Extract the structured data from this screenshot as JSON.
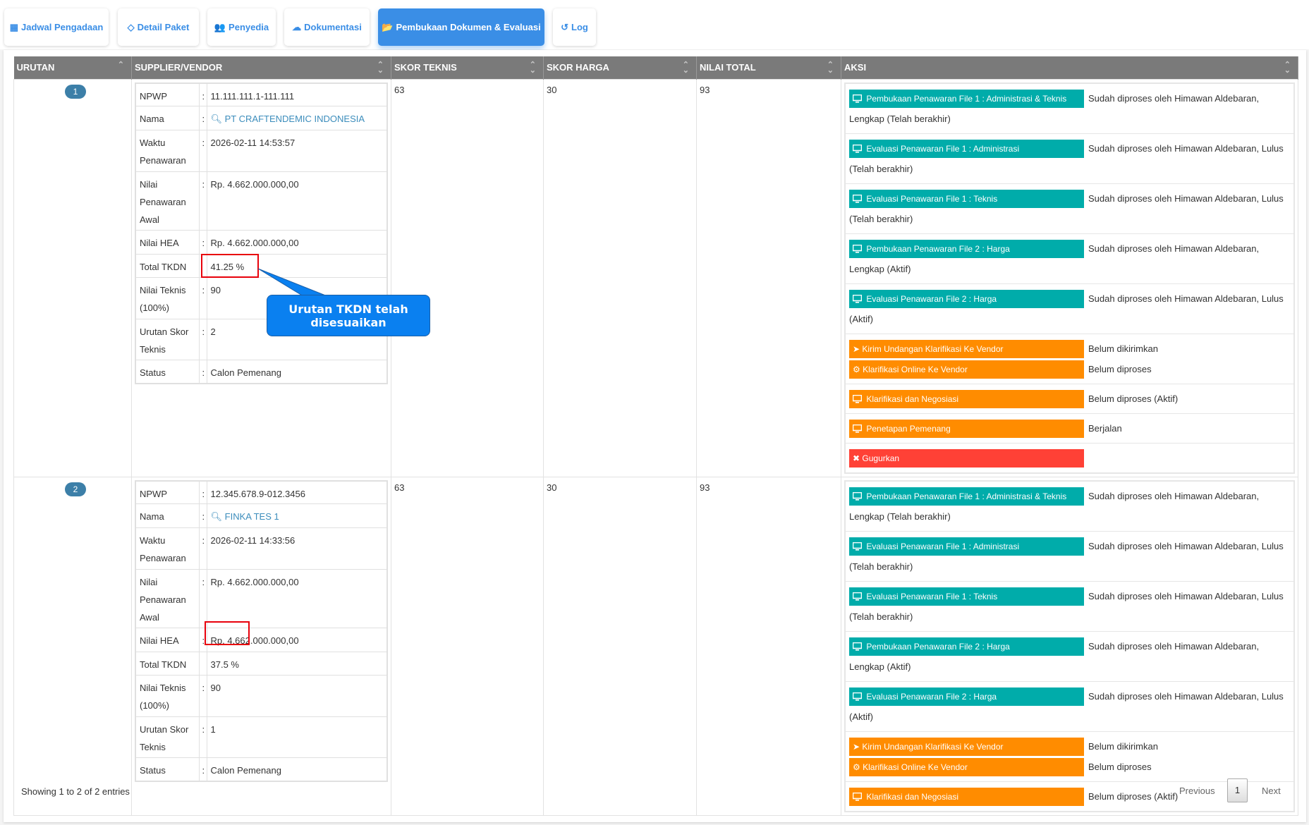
{
  "tabs": [
    {
      "label": "Jadwal Pengadaan",
      "icon": "calendar-icon",
      "glyph": "▦"
    },
    {
      "label": "Detail Paket",
      "icon": "diamond-icon",
      "glyph": "◇"
    },
    {
      "label": "Penyedia",
      "icon": "users-icon",
      "glyph": "👥"
    },
    {
      "label": "Dokumentasi",
      "icon": "cloud-download-icon",
      "glyph": "☁"
    },
    {
      "label": "Pembukaan Dokumen & Evaluasi",
      "icon": "folder-open-icon",
      "glyph": "📂"
    },
    {
      "label": "Log",
      "icon": "history-icon",
      "glyph": "↺"
    }
  ],
  "active_tab": 4,
  "headers": [
    "URUTAN",
    "SUPPLIER/VENDOR",
    "SKOR TEKNIS",
    "SKOR HARGA",
    "NILAI TOTAL",
    "AKSI"
  ],
  "colors": {
    "teal": "#00acaa",
    "orange": "#ff8c00",
    "red": "#ff4136",
    "header": "#7a7a7a",
    "accent": "#3a8ee6"
  },
  "labels": {
    "npwp": "NPWP",
    "nama": "Nama",
    "waktu": "Waktu Penawaran",
    "nilai_awal": "Nilai Penawaran Awal",
    "hea": "Nilai HEA",
    "tkdn": "Total TKDN",
    "teknis": "Nilai Teknis (100%)",
    "urutan": "Urutan Skor Teknis",
    "status": "Status",
    "colon": ":"
  },
  "rows": [
    {
      "urutan": "1",
      "npwp": "11.111.111.1-111.111",
      "nama": "PT CRAFTENDEMIC INDONESIA",
      "waktu": "2026-02-11 14:53:57",
      "nilai_awal": "Rp. 4.662.000.000,00",
      "hea": "Rp. 4.662.000.000,00",
      "tkdn": "41.25 %",
      "teknis": "90",
      "urutan_skor": "2",
      "status": "Calon Pemenang",
      "skor_teknis": "63",
      "skor_harga": "30",
      "nilai_total": "93",
      "aksi": [
        [
          {
            "label": "Pembukaan Penawaran File 1 : Administrasi & Teknis",
            "icon": "monitor",
            "color": "teal",
            "status": "Sudah diproses oleh Himawan Aldebaran, Lengkap (Telah berakhir)"
          }
        ],
        [
          {
            "label": "Evaluasi Penawaran File 1 : Administrasi",
            "icon": "monitor",
            "color": "teal",
            "status": "Sudah diproses oleh Himawan Aldebaran, Lulus (Telah berakhir)"
          }
        ],
        [
          {
            "label": "Evaluasi Penawaran File 1 : Teknis",
            "icon": "monitor",
            "color": "teal",
            "status": "Sudah diproses oleh Himawan Aldebaran, Lulus (Telah berakhir)"
          }
        ],
        [
          {
            "label": "Pembukaan Penawaran File 2 : Harga",
            "icon": "monitor",
            "color": "teal",
            "status": "Sudah diproses oleh Himawan Aldebaran, Lengkap (Aktif)"
          }
        ],
        [
          {
            "label": "Evaluasi Penawaran File 2 : Harga",
            "icon": "monitor",
            "color": "teal",
            "status": "Sudah diproses oleh Himawan Aldebaran, Lulus (Aktif)"
          }
        ],
        [
          {
            "label": "Kirim Undangan Klarifikasi Ke Vendor",
            "icon": "send",
            "color": "orange",
            "status": "Belum dikirimkan"
          },
          {
            "label": "Klarifikasi Online Ke Vendor",
            "icon": "gears",
            "color": "orange",
            "status": "Belum diproses"
          }
        ],
        [
          {
            "label": "Klarifikasi dan Negosiasi",
            "icon": "monitor",
            "color": "orange",
            "status": "Belum diproses (Aktif)"
          }
        ],
        [
          {
            "label": "Penetapan Pemenang",
            "icon": "monitor",
            "color": "orange",
            "status": "Berjalan"
          }
        ],
        [
          {
            "label": "Gugurkan",
            "icon": "close",
            "color": "red",
            "status": ""
          }
        ]
      ]
    },
    {
      "urutan": "2",
      "npwp": "12.345.678.9-012.3456",
      "nama": "FINKA TES 1",
      "waktu": "2026-02-11 14:33:56",
      "nilai_awal": "Rp. 4.662.000.000,00",
      "hea": "Rp. 4.662.000.000,00",
      "tkdn": "37.5 %",
      "teknis": "90",
      "urutan_skor": "1",
      "status": "Calon Pemenang",
      "skor_teknis": "63",
      "skor_harga": "30",
      "nilai_total": "93",
      "aksi": [
        [
          {
            "label": "Pembukaan Penawaran File 1 : Administrasi & Teknis",
            "icon": "monitor",
            "color": "teal",
            "status": "Sudah diproses oleh Himawan Aldebaran, Lengkap (Telah berakhir)"
          }
        ],
        [
          {
            "label": "Evaluasi Penawaran File 1 : Administrasi",
            "icon": "monitor",
            "color": "teal",
            "status": "Sudah diproses oleh Himawan Aldebaran, Lulus (Telah berakhir)"
          }
        ],
        [
          {
            "label": "Evaluasi Penawaran File 1 : Teknis",
            "icon": "monitor",
            "color": "teal",
            "status": "Sudah diproses oleh Himawan Aldebaran, Lulus (Telah berakhir)"
          }
        ],
        [
          {
            "label": "Pembukaan Penawaran File 2 : Harga",
            "icon": "monitor",
            "color": "teal",
            "status": "Sudah diproses oleh Himawan Aldebaran, Lengkap (Aktif)"
          }
        ],
        [
          {
            "label": "Evaluasi Penawaran File 2 : Harga",
            "icon": "monitor",
            "color": "teal",
            "status": "Sudah diproses oleh Himawan Aldebaran, Lulus (Aktif)"
          }
        ],
        [
          {
            "label": "Kirim Undangan Klarifikasi Ke Vendor",
            "icon": "send",
            "color": "orange",
            "status": "Belum dikirimkan"
          },
          {
            "label": "Klarifikasi Online Ke Vendor",
            "icon": "gears",
            "color": "orange",
            "status": "Belum diproses"
          }
        ],
        [
          {
            "label": "Klarifikasi dan Negosiasi",
            "icon": "monitor",
            "color": "orange",
            "status": "Belum diproses (Aktif)"
          }
        ]
      ]
    }
  ],
  "callout": {
    "text": "Urutan TKDN telah disesuaikan"
  },
  "footer": {
    "info": "Showing 1 to 2 of 2 entries",
    "previous": "Previous",
    "page": "1",
    "next": "Next"
  }
}
